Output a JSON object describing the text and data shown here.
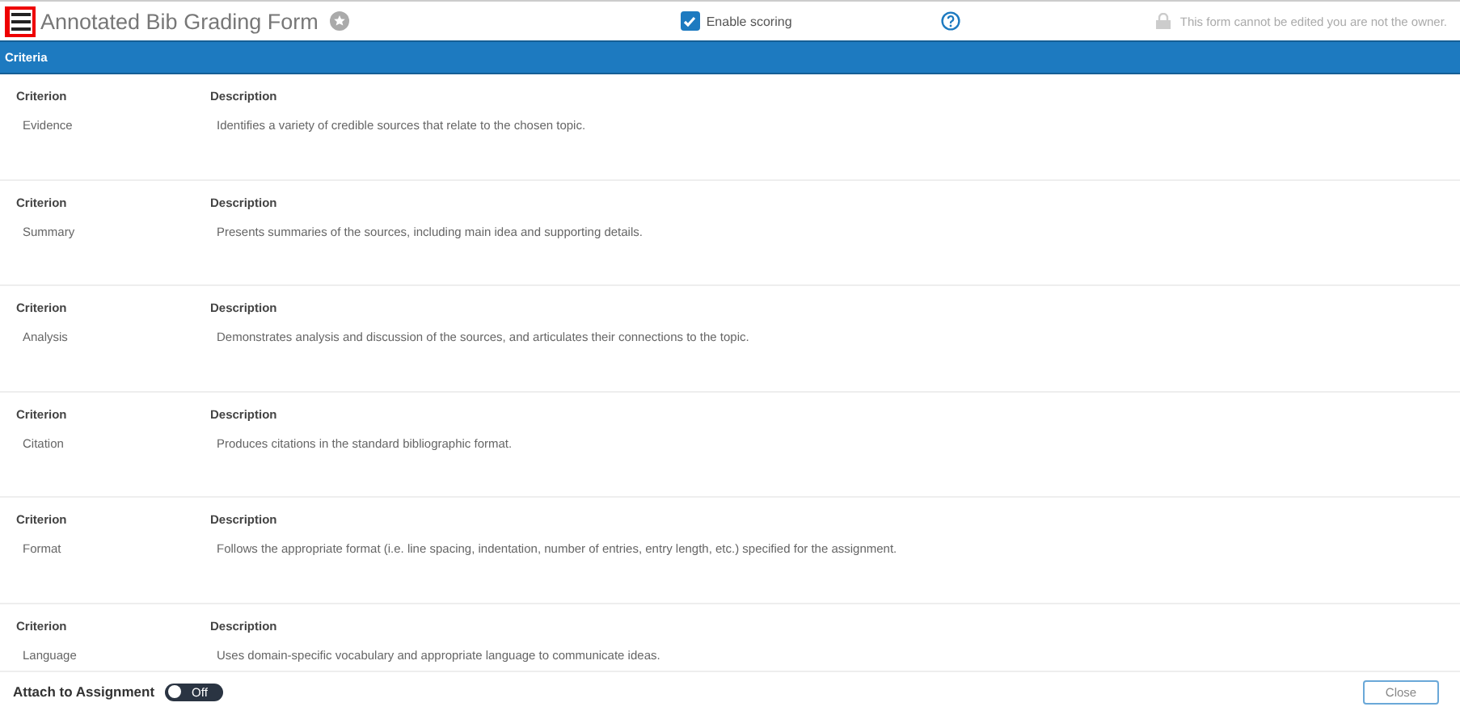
{
  "header": {
    "title": "Annotated Bib Grading Form",
    "enable_scoring": {
      "label": "Enable scoring",
      "checked": true
    },
    "notice": "This form cannot be edited you are not the owner."
  },
  "section": {
    "title": "Criteria"
  },
  "criteria": [
    {
      "criterion_label": "Criterion",
      "description_label": "Description",
      "criterion": "Evidence",
      "description": "Identifies a variety of credible sources that relate to the chosen topic."
    },
    {
      "criterion_label": "Criterion",
      "description_label": "Description",
      "criterion": "Summary",
      "description": "Presents summaries of the sources, including main idea and supporting details."
    },
    {
      "criterion_label": "Criterion",
      "description_label": "Description",
      "criterion": "Analysis",
      "description": "Demonstrates analysis and discussion of the sources, and articulates their connections to the topic."
    },
    {
      "criterion_label": "Criterion",
      "description_label": "Description",
      "criterion": "Citation",
      "description": "Produces citations in the standard bibliographic format."
    },
    {
      "criterion_label": "Criterion",
      "description_label": "Description",
      "criterion": "Format",
      "description": "Follows the appropriate format (i.e. line spacing, indentation, number of entries, entry length, etc.) specified for the assignment."
    },
    {
      "criterion_label": "Criterion",
      "description_label": "Description",
      "criterion": "Language",
      "description": "Uses domain-specific vocabulary and appropriate language to communicate ideas."
    }
  ],
  "footer": {
    "attach_label": "Attach to Assignment",
    "attach_toggle": {
      "label": "Off",
      "on": false
    },
    "close_button": "Close"
  }
}
